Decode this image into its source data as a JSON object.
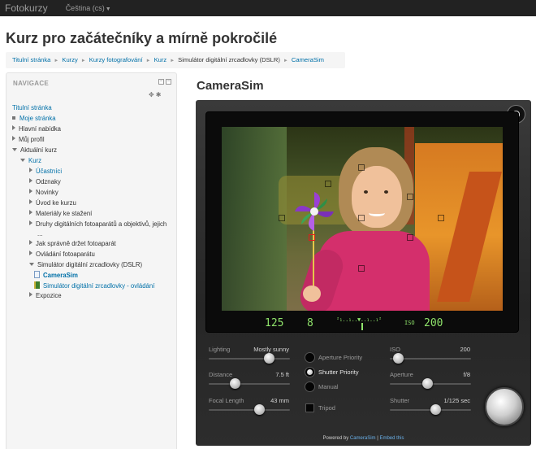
{
  "navbar": {
    "brand": "Fotokurzy",
    "language": "Čeština (cs)"
  },
  "page": {
    "title": "Kurz pro začátečníky a mírně pokročilé"
  },
  "breadcrumb": [
    "Titulní stránka",
    "Kurzy",
    "Kurzy fotografování",
    "Kurz",
    "Simulátor digitální zrcadlovky (DSLR)",
    "CameraSim"
  ],
  "navigation": {
    "title": "NAVIGACE",
    "items": {
      "home": "Titulní stránka",
      "my_page": "Moje stránka",
      "main_menu": "Hlavní nabídka",
      "my_profile": "Můj profil",
      "current_course": "Aktuální kurz",
      "course": "Kurz",
      "participants": "Účastníci",
      "badges": "Odznaky",
      "news": "Novinky",
      "intro": "Úvod ke kurzu",
      "downloads": "Materiály ke stažení",
      "camera_types": "Druhy digitálních fotoaparátů a objektivů, jejich",
      "camera_types_more": "...",
      "hold_camera": "Jak správně držet fotoaparát",
      "camera_controls": "Ovládání fotoaparátu",
      "dslr_sim": "Simulátor digitální zrcadlovky (DSLR)",
      "camerasim": "CameraSim",
      "dslr_controls": "Simulátor digitální zrcadlovky - ovládání",
      "exposure": "Expozice"
    }
  },
  "camerasim": {
    "heading": "CameraSim",
    "readout": {
      "shutter": "125",
      "aperture": "8",
      "iso_label": "ISO",
      "iso": "200",
      "meter": "²₁..₁..▼..₁..₁²"
    },
    "controls": {
      "lighting": {
        "label": "Lighting",
        "value": "Mostly sunny",
        "level": 0.74
      },
      "distance": {
        "label": "Distance",
        "value": "7.5 ft",
        "level": 0.32
      },
      "focal_length": {
        "label": "Focal Length",
        "value": "43 mm",
        "level": 0.62
      },
      "iso": {
        "label": "ISO",
        "value": "200",
        "level": 0.1
      },
      "aperture": {
        "label": "Aperture",
        "value": "f/8",
        "level": 0.46
      },
      "shutter": {
        "label": "Shutter",
        "value": "1/125 sec",
        "level": 0.56
      }
    },
    "modes": {
      "aperture_priority": "Aperture Priority",
      "shutter_priority": "Shutter Priority",
      "manual": "Manual",
      "selected": "shutter_priority"
    },
    "tripod": "Tripod",
    "footer": {
      "prefix": "Powered by ",
      "link": "CameraSim",
      "sep": " | ",
      "embed": "Embed this"
    }
  },
  "colors": {
    "accent": "#0070a8",
    "lcd": "#8fe36b",
    "navbar": "#222222"
  }
}
